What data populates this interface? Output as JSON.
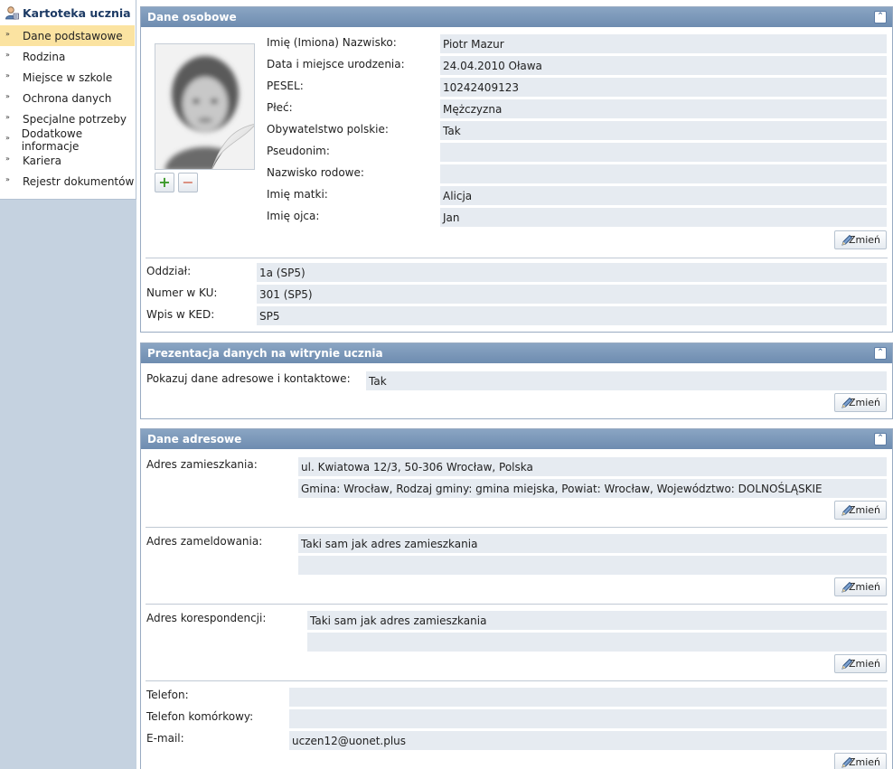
{
  "sidebar": {
    "title": "Kartoteka ucznia",
    "items": [
      {
        "label": "Dane podstawowe",
        "active": true
      },
      {
        "label": "Rodzina"
      },
      {
        "label": "Miejsce w szkole"
      },
      {
        "label": "Ochrona danych"
      },
      {
        "label": "Specjalne potrzeby"
      },
      {
        "label": "Dodatkowe informacje"
      },
      {
        "label": "Kariera"
      },
      {
        "label": "Rejestr dokumentów"
      }
    ],
    "arrow": "»"
  },
  "personal": {
    "title": "Dane osobowe",
    "collapse": "⌃",
    "add": "+",
    "remove": "−",
    "fields": [
      {
        "label": "Imię (Imiona) Nazwisko:",
        "value": "Piotr Mazur"
      },
      {
        "label": "Data i miejsce urodzenia:",
        "value": "24.04.2010 Oława"
      },
      {
        "label": "PESEL:",
        "value": "10242409123"
      },
      {
        "label": "Płeć:",
        "value": "Mężczyzna"
      },
      {
        "label": "Obywatelstwo polskie:",
        "value": "Tak"
      },
      {
        "label": "Pseudonim:",
        "value": ""
      },
      {
        "label": "Nazwisko rodowe:",
        "value": ""
      },
      {
        "label": "Imię matki:",
        "value": "Alicja"
      },
      {
        "label": "Imię ojca:",
        "value": "Jan"
      }
    ],
    "change_label": "Zmień",
    "school": [
      {
        "label": "Oddział:",
        "value": "1a (SP5)"
      },
      {
        "label": "Numer w KU:",
        "value": "301 (SP5)"
      },
      {
        "label": "Wpis w KED:",
        "value": "SP5"
      }
    ]
  },
  "presentation": {
    "title": "Prezentacja danych na witrynie ucznia",
    "label": "Pokazuj dane adresowe i kontaktowe:",
    "value": "Tak",
    "change_label": "Zmień"
  },
  "address": {
    "title": "Dane adresowe",
    "residence_label": "Adres zamieszkania:",
    "residence_line1": "ul. Kwiatowa 12/3, 50-306 Wrocław, Polska",
    "residence_line2": "Gmina: Wrocław, Rodzaj gminy: gmina miejska, Powiat: Wrocław, Województwo: DOLNOŚLĄSKIE",
    "registered_label": "Adres zameldowania:",
    "registered_line1": "Taki sam jak adres zamieszkania",
    "registered_line2": "",
    "correspondence_label": "Adres korespondencji:",
    "correspondence_line1": "Taki sam jak adres zamieszkania",
    "correspondence_line2": "",
    "phone_label": "Telefon:",
    "phone_value": "",
    "mobile_label": "Telefon komórkowy:",
    "mobile_value": "",
    "email_label": "E-mail:",
    "email_value": "uczen12@uonet.plus",
    "change_label": "Zmień"
  }
}
